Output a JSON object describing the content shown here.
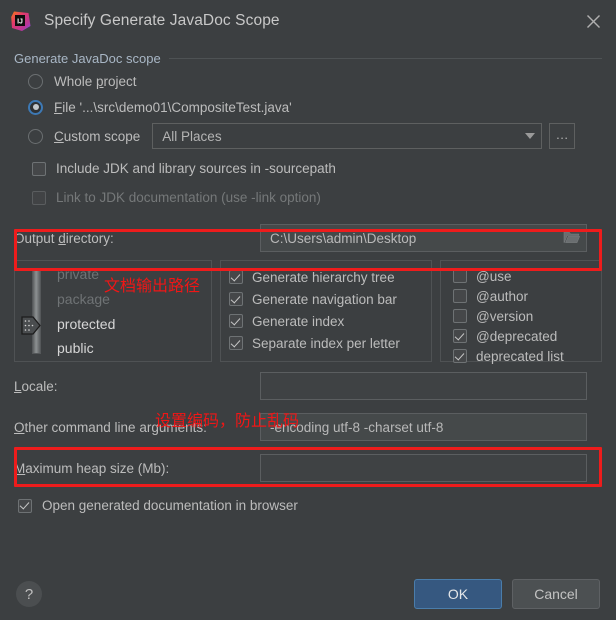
{
  "window": {
    "title": "Specify Generate JavaDoc Scope",
    "app_icon": "intellij-idea-icon",
    "close_icon": "close-icon"
  },
  "scope_group": {
    "legend": "Generate JavaDoc scope",
    "options": [
      {
        "label_pre": "Whole ",
        "mnemonic": "p",
        "label_post": "roject",
        "checked": false
      },
      {
        "label_pre": "",
        "mnemonic": "F",
        "label_post": "ile '...\\src\\demo01\\CompositeTest.java'",
        "checked": true
      },
      {
        "label_pre": "",
        "mnemonic": "C",
        "label_post": "ustom scope",
        "checked": false
      }
    ],
    "custom_scope_combo": {
      "value": "All Places",
      "caret_icon": "chevron-down-icon"
    },
    "browse_button": "..."
  },
  "checkboxes_top": [
    {
      "label": "Include JDK and library sources in -sourcepath",
      "checked": false,
      "disabled": false
    },
    {
      "label": "Link to JDK documentation (use -link option)",
      "checked": false,
      "disabled": true
    }
  ],
  "output_directory": {
    "label_pre": "Output ",
    "mnemonic": "d",
    "label_post": "irectory:",
    "value": "C:\\Users\\admin\\Desktop",
    "folder_icon": "folder-icon"
  },
  "visibility": {
    "levels": [
      "private",
      "package",
      "protected",
      "public"
    ],
    "selected": "protected"
  },
  "generate_options": [
    {
      "label": "Generate hierarchy tree",
      "checked": true
    },
    {
      "label": "Generate navigation bar",
      "checked": true
    },
    {
      "label": "Generate index",
      "checked": true
    },
    {
      "label": "Separate index per letter",
      "checked": true
    }
  ],
  "tag_options": [
    {
      "label": "@use",
      "checked": false
    },
    {
      "label": "@author",
      "checked": false
    },
    {
      "label": "@version",
      "checked": false
    },
    {
      "label": "@deprecated",
      "checked": true
    },
    {
      "label": "deprecated list",
      "checked": true
    }
  ],
  "locale": {
    "label_pre": "",
    "mnemonic": "L",
    "label_post": "ocale:",
    "value": ""
  },
  "other_args": {
    "label_pre": "",
    "mnemonic": "O",
    "label_post": "ther command line arguments:",
    "value": "-encoding utf-8 -charset utf-8"
  },
  "heap": {
    "label_pre": "",
    "mnemonic": "M",
    "label_post": "aximum heap size (Mb):",
    "value": ""
  },
  "open_browser": {
    "label_pre": "Open ",
    "mnemonic": "g",
    "label_post": "enerated documentation in browser",
    "checked": true
  },
  "footer": {
    "help_label": "?",
    "ok_label": "OK",
    "cancel_label": "Cancel"
  },
  "annotations": {
    "output_path_note": "文档输出路径",
    "encoding_note": "设置编码，防止乱码",
    "highlight_color": "#ee1c1c"
  }
}
